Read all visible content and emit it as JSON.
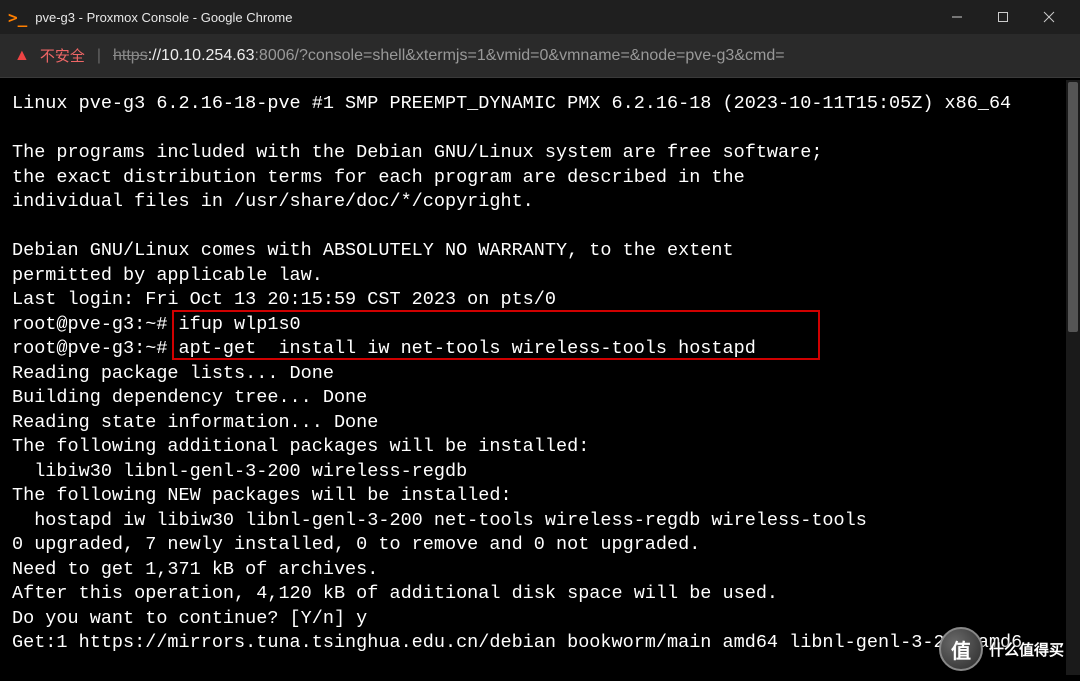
{
  "window": {
    "title": "pve-g3 - Proxmox Console - Google Chrome"
  },
  "addressbar": {
    "warn_label": "不安全",
    "proto": "https",
    "host": "://10.10.254.63",
    "path": ":8006/?console=shell&xtermjs=1&vmid=0&vmname=&node=pve-g3&cmd="
  },
  "terminal": {
    "lines": [
      "Linux pve-g3 6.2.16-18-pve #1 SMP PREEMPT_DYNAMIC PMX 6.2.16-18 (2023-10-11T15:05Z) x86_64",
      "",
      "The programs included with the Debian GNU/Linux system are free software;",
      "the exact distribution terms for each program are described in the",
      "individual files in /usr/share/doc/*/copyright.",
      "",
      "Debian GNU/Linux comes with ABSOLUTELY NO WARRANTY, to the extent",
      "permitted by applicable law.",
      "Last login: Fri Oct 13 20:15:59 CST 2023 on pts/0",
      "root@pve-g3:~# ifup wlp1s0",
      "root@pve-g3:~# apt-get  install iw net-tools wireless-tools hostapd",
      "Reading package lists... Done",
      "Building dependency tree... Done",
      "Reading state information... Done",
      "The following additional packages will be installed:",
      "  libiw30 libnl-genl-3-200 wireless-regdb",
      "The following NEW packages will be installed:",
      "  hostapd iw libiw30 libnl-genl-3-200 net-tools wireless-regdb wireless-tools",
      "0 upgraded, 7 newly installed, 0 to remove and 0 not upgraded.",
      "Need to get 1,371 kB of archives.",
      "After this operation, 4,120 kB of additional disk space will be used.",
      "Do you want to continue? [Y/n] y",
      "Get:1 https://mirrors.tuna.tsinghua.edu.cn/debian bookworm/main amd64 libnl-genl-3-200 amd6"
    ]
  },
  "badge": {
    "symbol": "值",
    "text": "什么值得买"
  }
}
